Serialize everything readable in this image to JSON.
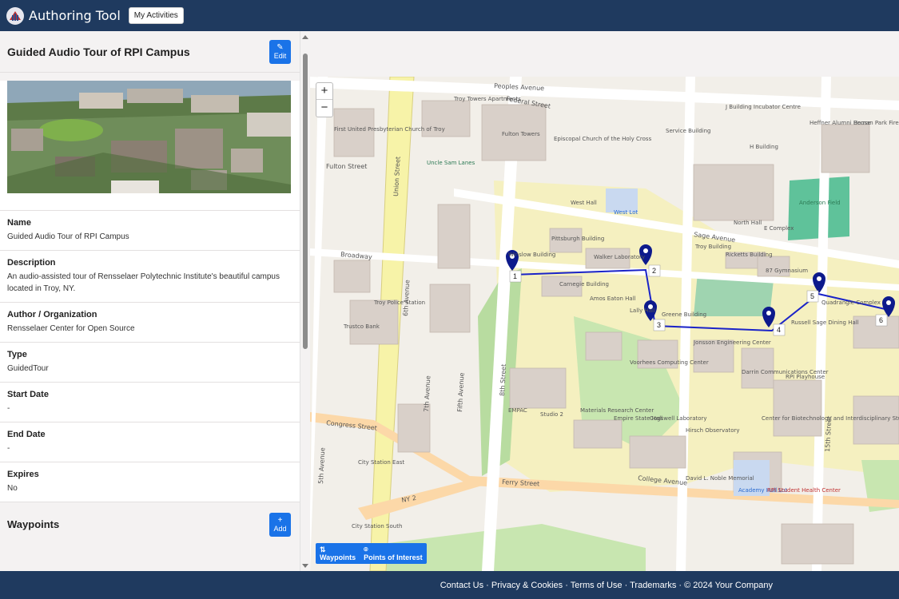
{
  "header": {
    "app_title": "Authoring Tool",
    "my_activities": "My Activities"
  },
  "activity": {
    "title": "Guided Audio Tour of RPI Campus",
    "edit_label": "Edit",
    "fields": [
      {
        "label": "Name",
        "value": "Guided Audio Tour of RPI Campus"
      },
      {
        "label": "Description",
        "value": "An audio-assisted tour of Rensselaer Polytechnic Institute's beautiful campus located in Troy, NY."
      },
      {
        "label": "Author / Organization",
        "value": "Rensselaer Center for Open Source"
      },
      {
        "label": "Type",
        "value": "GuidedTour"
      },
      {
        "label": "Start Date",
        "value": "-"
      },
      {
        "label": "End Date",
        "value": "-"
      },
      {
        "label": "Expires",
        "value": "No"
      }
    ],
    "waypoints_title": "Waypoints",
    "add_label": "Add"
  },
  "map": {
    "zoom_in": "+",
    "zoom_out": "−",
    "tabs": [
      {
        "label": "Waypoints",
        "icon": "route-icon"
      },
      {
        "label": "Points of Interest",
        "icon": "map-pin-icon"
      }
    ],
    "waypoint_numbers": [
      "1",
      "2",
      "3",
      "4",
      "5",
      "6"
    ],
    "street_labels": [
      "Peoples Avenue",
      "Federal Street",
      "Fulton Street",
      "Broadway",
      "Congress Street",
      "Ferry Street",
      "6th Avenue",
      "8th Street",
      "Sage Avenue",
      "College Avenue",
      "15th Street",
      "5th Avenue",
      "Union Street",
      "7th Avenue",
      "Fifth Avenue",
      "NY 2"
    ],
    "place_labels": [
      "West Hall",
      "West Lot",
      "Pittsburgh Building",
      "Walker Laboratory",
      "Carnegie Building",
      "Amos Eaton Hall",
      "Lally Hall",
      "Greene Building",
      "Jonsson Engineering Center",
      "Voorhees Computing Center",
      "Darrin Communications Center",
      "RPI Playhouse",
      "Center for Biotechnology and Interdisciplinary Studies",
      "Cogswell Laboratory",
      "Materials Research Center",
      "Empire State Hall",
      "Troy Building",
      "Ricketts Building",
      "87 Gymnasium",
      "Russell Sage Dining Hall",
      "Quadrangle Complex",
      "North Hall",
      "E Complex",
      "Anderson Field",
      "Academy Hall Lot",
      "RPI Student Health Center",
      "David L. Noble Memorial",
      "Hirsch Observatory",
      "EMPAC",
      "Studio 2",
      "City Station East",
      "City Station South",
      "Troy Police Station",
      "Trustco Bank",
      "Uncle Sam Lanes",
      "Fulton Towers",
      "Troy Towers Apartments",
      "Service Building",
      "J Building Incubator Centre",
      "H Building",
      "Heffner Alumni House",
      "Beman Park Firehouse",
      "Winslow Building",
      "Episcopal Church of the Holy Cross",
      "First United Presbyterian Church of Troy"
    ]
  },
  "footer": {
    "text": "Contact Us · Privacy & Cookies · Terms of Use · Trademarks · © 2024 Your Company"
  },
  "colors": {
    "navy": "#1f3a5f",
    "accent": "#1a73e8",
    "route": "#1a23c8",
    "campus": "#f5f0c0",
    "park": "#c8e6b0"
  }
}
